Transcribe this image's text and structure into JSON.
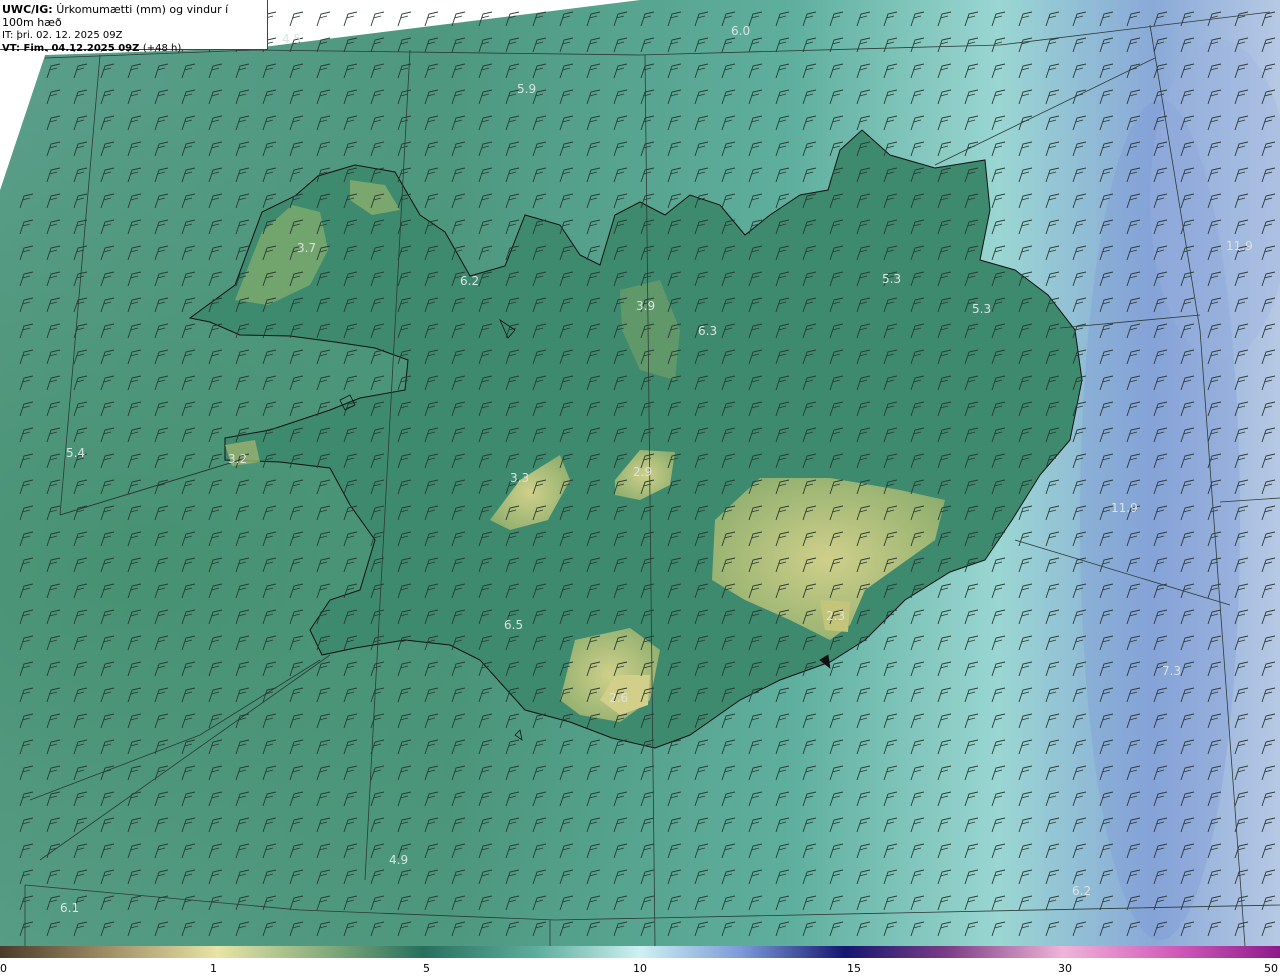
{
  "header": {
    "model": "UWC/IG:",
    "title": "Úrkomumætti (mm) og vindur í 100m hæð",
    "issue_time": "IT: þri. 02. 12. 2025 09Z",
    "valid_prefix": "VT: Fim. 04.12.2025 09Z",
    "lead_time": "(+48 h)"
  },
  "map_values": [
    {
      "id": "nw-sea",
      "text": "4.5"
    },
    {
      "id": "north-sea-top",
      "text": "6.0"
    },
    {
      "id": "north-sea",
      "text": "5.9"
    },
    {
      "id": "westfjords",
      "text": "3.7"
    },
    {
      "id": "hunafloi",
      "text": "6.2"
    },
    {
      "id": "trollaskagi",
      "text": "3.9"
    },
    {
      "id": "eyjafjordur",
      "text": "6.3"
    },
    {
      "id": "ne-highland",
      "text": "5.3"
    },
    {
      "id": "ne-coast",
      "text": "5.3"
    },
    {
      "id": "east-sea-top",
      "text": "11.9"
    },
    {
      "id": "west-sea",
      "text": "5.4"
    },
    {
      "id": "snaefellsnes",
      "text": "3.2"
    },
    {
      "id": "langjokull",
      "text": "3.3"
    },
    {
      "id": "hofsjokull",
      "text": "2.9"
    },
    {
      "id": "east-sea",
      "text": "11.9"
    },
    {
      "id": "oraefajokull",
      "text": "2.3"
    },
    {
      "id": "south-lowland",
      "text": "6.5"
    },
    {
      "id": "myrdalsjokull",
      "text": "2.6"
    },
    {
      "id": "se-sea",
      "text": "7.3"
    },
    {
      "id": "south-sea",
      "text": "4.9"
    },
    {
      "id": "sw-sea",
      "text": "6.1"
    },
    {
      "id": "s-east-sea",
      "text": "6.2"
    }
  ],
  "colorbar": {
    "ticks": [
      "0",
      "1",
      "5",
      "10",
      "15",
      "30",
      "50"
    ]
  },
  "colors": {
    "sea": "#4f9c8a",
    "land": "#3f8a6f",
    "glacier": "#b9c27a",
    "high_precip": "#7f9ad6",
    "barb": "#2a3a34",
    "coast": "#111111",
    "grid": "#2c3a36"
  }
}
